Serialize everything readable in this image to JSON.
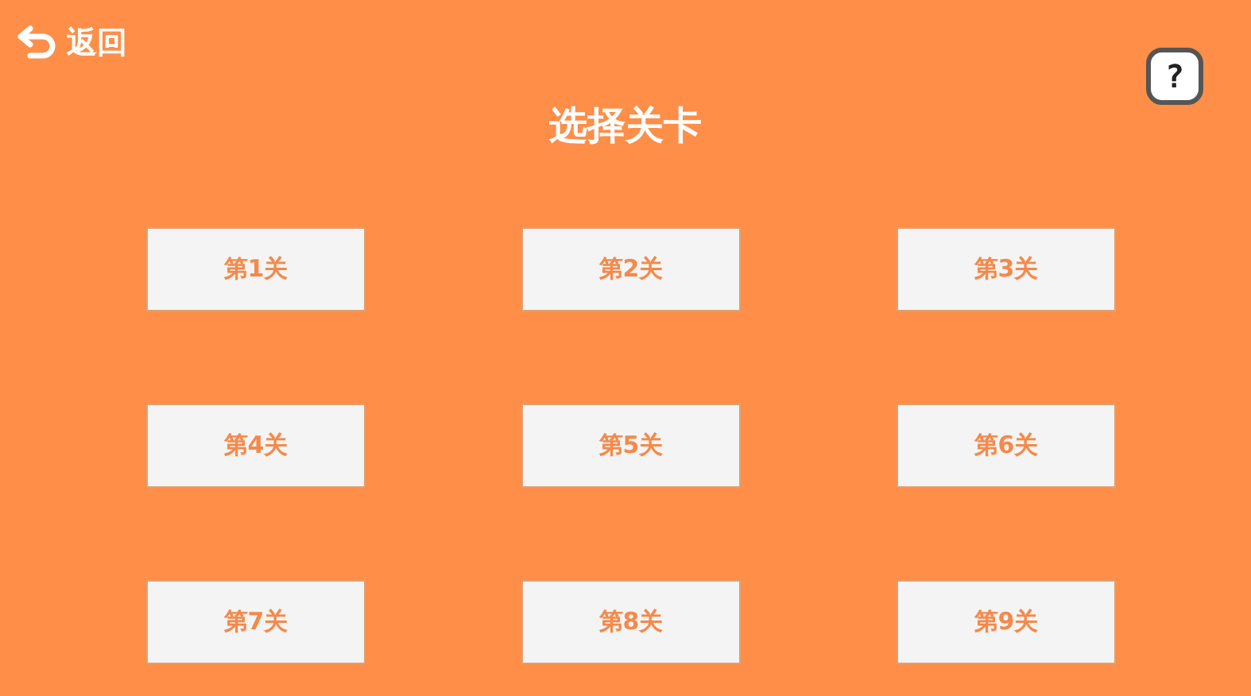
{
  "back_button": {
    "label": "返回"
  },
  "title": "选择关卡",
  "help_button": {
    "label": "?"
  },
  "levels": [
    {
      "label": "第1关"
    },
    {
      "label": "第2关"
    },
    {
      "label": "第3关"
    },
    {
      "label": "第4关"
    },
    {
      "label": "第5关"
    },
    {
      "label": "第6关"
    },
    {
      "label": "第7关"
    },
    {
      "label": "第8关"
    },
    {
      "label": "第9关"
    }
  ]
}
